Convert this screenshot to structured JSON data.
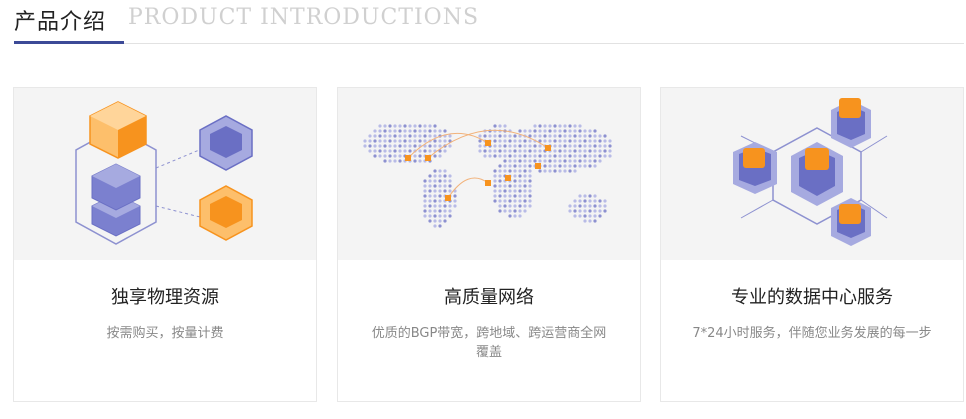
{
  "header": {
    "title": "产品介绍",
    "subtitle": "PRODUCT INTRODUCTIONS"
  },
  "cards": [
    {
      "title": "独享物理资源",
      "desc": "按需购买，按量计费"
    },
    {
      "title": "高质量网络",
      "desc": "优质的BGP带宽，跨地域、跨运营商全网覆盖"
    },
    {
      "title": "专业的数据中心服务",
      "desc": "7*24小时服务，伴随您业务发展的每一步"
    }
  ],
  "colors": {
    "accent": "#3c4a97",
    "orange": "#f7931e",
    "purple": "#6a6fc4",
    "background": "#f4f4f4"
  }
}
